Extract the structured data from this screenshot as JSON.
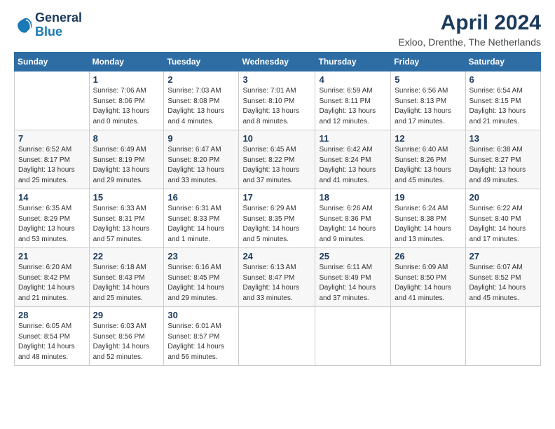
{
  "logo": {
    "general": "General",
    "blue": "Blue"
  },
  "header": {
    "title": "April 2024",
    "subtitle": "Exloo, Drenthe, The Netherlands"
  },
  "days_of_week": [
    "Sunday",
    "Monday",
    "Tuesday",
    "Wednesday",
    "Thursday",
    "Friday",
    "Saturday"
  ],
  "weeks": [
    [
      {
        "day": "",
        "sunrise": "",
        "sunset": "",
        "daylight": ""
      },
      {
        "day": "1",
        "sunrise": "Sunrise: 7:06 AM",
        "sunset": "Sunset: 8:06 PM",
        "daylight": "Daylight: 13 hours and 0 minutes."
      },
      {
        "day": "2",
        "sunrise": "Sunrise: 7:03 AM",
        "sunset": "Sunset: 8:08 PM",
        "daylight": "Daylight: 13 hours and 4 minutes."
      },
      {
        "day": "3",
        "sunrise": "Sunrise: 7:01 AM",
        "sunset": "Sunset: 8:10 PM",
        "daylight": "Daylight: 13 hours and 8 minutes."
      },
      {
        "day": "4",
        "sunrise": "Sunrise: 6:59 AM",
        "sunset": "Sunset: 8:11 PM",
        "daylight": "Daylight: 13 hours and 12 minutes."
      },
      {
        "day": "5",
        "sunrise": "Sunrise: 6:56 AM",
        "sunset": "Sunset: 8:13 PM",
        "daylight": "Daylight: 13 hours and 17 minutes."
      },
      {
        "day": "6",
        "sunrise": "Sunrise: 6:54 AM",
        "sunset": "Sunset: 8:15 PM",
        "daylight": "Daylight: 13 hours and 21 minutes."
      }
    ],
    [
      {
        "day": "7",
        "sunrise": "Sunrise: 6:52 AM",
        "sunset": "Sunset: 8:17 PM",
        "daylight": "Daylight: 13 hours and 25 minutes."
      },
      {
        "day": "8",
        "sunrise": "Sunrise: 6:49 AM",
        "sunset": "Sunset: 8:19 PM",
        "daylight": "Daylight: 13 hours and 29 minutes."
      },
      {
        "day": "9",
        "sunrise": "Sunrise: 6:47 AM",
        "sunset": "Sunset: 8:20 PM",
        "daylight": "Daylight: 13 hours and 33 minutes."
      },
      {
        "day": "10",
        "sunrise": "Sunrise: 6:45 AM",
        "sunset": "Sunset: 8:22 PM",
        "daylight": "Daylight: 13 hours and 37 minutes."
      },
      {
        "day": "11",
        "sunrise": "Sunrise: 6:42 AM",
        "sunset": "Sunset: 8:24 PM",
        "daylight": "Daylight: 13 hours and 41 minutes."
      },
      {
        "day": "12",
        "sunrise": "Sunrise: 6:40 AM",
        "sunset": "Sunset: 8:26 PM",
        "daylight": "Daylight: 13 hours and 45 minutes."
      },
      {
        "day": "13",
        "sunrise": "Sunrise: 6:38 AM",
        "sunset": "Sunset: 8:27 PM",
        "daylight": "Daylight: 13 hours and 49 minutes."
      }
    ],
    [
      {
        "day": "14",
        "sunrise": "Sunrise: 6:35 AM",
        "sunset": "Sunset: 8:29 PM",
        "daylight": "Daylight: 13 hours and 53 minutes."
      },
      {
        "day": "15",
        "sunrise": "Sunrise: 6:33 AM",
        "sunset": "Sunset: 8:31 PM",
        "daylight": "Daylight: 13 hours and 57 minutes."
      },
      {
        "day": "16",
        "sunrise": "Sunrise: 6:31 AM",
        "sunset": "Sunset: 8:33 PM",
        "daylight": "Daylight: 14 hours and 1 minute."
      },
      {
        "day": "17",
        "sunrise": "Sunrise: 6:29 AM",
        "sunset": "Sunset: 8:35 PM",
        "daylight": "Daylight: 14 hours and 5 minutes."
      },
      {
        "day": "18",
        "sunrise": "Sunrise: 6:26 AM",
        "sunset": "Sunset: 8:36 PM",
        "daylight": "Daylight: 14 hours and 9 minutes."
      },
      {
        "day": "19",
        "sunrise": "Sunrise: 6:24 AM",
        "sunset": "Sunset: 8:38 PM",
        "daylight": "Daylight: 14 hours and 13 minutes."
      },
      {
        "day": "20",
        "sunrise": "Sunrise: 6:22 AM",
        "sunset": "Sunset: 8:40 PM",
        "daylight": "Daylight: 14 hours and 17 minutes."
      }
    ],
    [
      {
        "day": "21",
        "sunrise": "Sunrise: 6:20 AM",
        "sunset": "Sunset: 8:42 PM",
        "daylight": "Daylight: 14 hours and 21 minutes."
      },
      {
        "day": "22",
        "sunrise": "Sunrise: 6:18 AM",
        "sunset": "Sunset: 8:43 PM",
        "daylight": "Daylight: 14 hours and 25 minutes."
      },
      {
        "day": "23",
        "sunrise": "Sunrise: 6:16 AM",
        "sunset": "Sunset: 8:45 PM",
        "daylight": "Daylight: 14 hours and 29 minutes."
      },
      {
        "day": "24",
        "sunrise": "Sunrise: 6:13 AM",
        "sunset": "Sunset: 8:47 PM",
        "daylight": "Daylight: 14 hours and 33 minutes."
      },
      {
        "day": "25",
        "sunrise": "Sunrise: 6:11 AM",
        "sunset": "Sunset: 8:49 PM",
        "daylight": "Daylight: 14 hours and 37 minutes."
      },
      {
        "day": "26",
        "sunrise": "Sunrise: 6:09 AM",
        "sunset": "Sunset: 8:50 PM",
        "daylight": "Daylight: 14 hours and 41 minutes."
      },
      {
        "day": "27",
        "sunrise": "Sunrise: 6:07 AM",
        "sunset": "Sunset: 8:52 PM",
        "daylight": "Daylight: 14 hours and 45 minutes."
      }
    ],
    [
      {
        "day": "28",
        "sunrise": "Sunrise: 6:05 AM",
        "sunset": "Sunset: 8:54 PM",
        "daylight": "Daylight: 14 hours and 48 minutes."
      },
      {
        "day": "29",
        "sunrise": "Sunrise: 6:03 AM",
        "sunset": "Sunset: 8:56 PM",
        "daylight": "Daylight: 14 hours and 52 minutes."
      },
      {
        "day": "30",
        "sunrise": "Sunrise: 6:01 AM",
        "sunset": "Sunset: 8:57 PM",
        "daylight": "Daylight: 14 hours and 56 minutes."
      },
      {
        "day": "",
        "sunrise": "",
        "sunset": "",
        "daylight": ""
      },
      {
        "day": "",
        "sunrise": "",
        "sunset": "",
        "daylight": ""
      },
      {
        "day": "",
        "sunrise": "",
        "sunset": "",
        "daylight": ""
      },
      {
        "day": "",
        "sunrise": "",
        "sunset": "",
        "daylight": ""
      }
    ]
  ]
}
